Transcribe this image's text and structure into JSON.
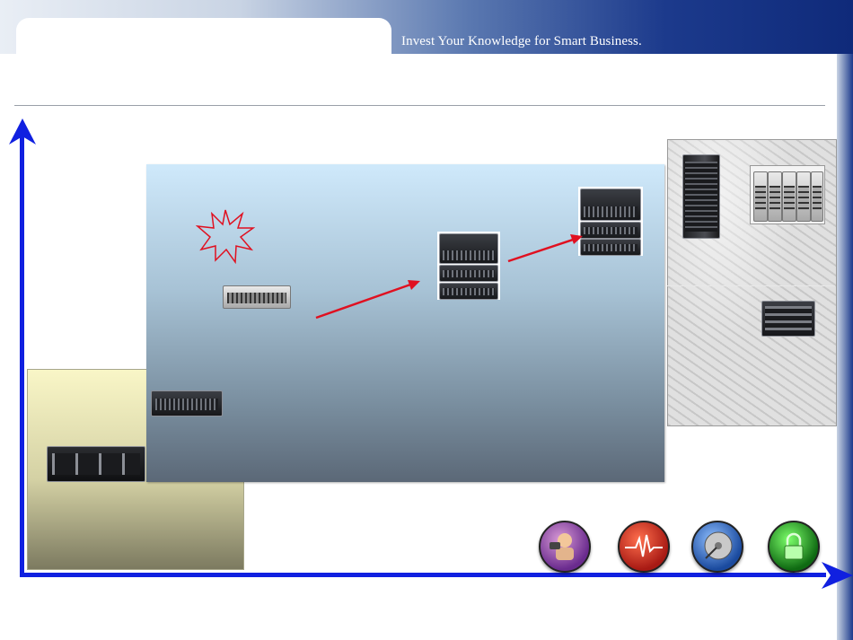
{
  "header": {
    "tagline": "Invest Your Knowledge for Smart Business."
  },
  "colors": {
    "axis": "#1020e0",
    "arrow": "#e01020",
    "header_dark": "#0f2a7a"
  },
  "icons": {
    "starburst": "burst-icon",
    "bottom": [
      "person-icon",
      "heartbeat-icon",
      "disk-icon",
      "lock-icon"
    ]
  }
}
